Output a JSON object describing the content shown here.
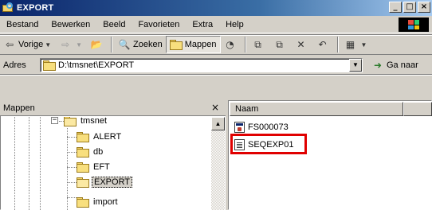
{
  "window": {
    "title": "EXPORT",
    "controls": [
      "_",
      "□",
      "×"
    ]
  },
  "menu": {
    "items": [
      "Bestand",
      "Bewerken",
      "Beeld",
      "Favorieten",
      "Extra",
      "Help"
    ]
  },
  "toolbar": {
    "back_label": "Vorige",
    "search_label": "Zoeken",
    "folders_label": "Mappen"
  },
  "address": {
    "label": "Adres",
    "value": "D:\\tmsnet\\EXPORT",
    "go_label": "Ga naar"
  },
  "folders_panel": {
    "title": "Mappen",
    "close": "×",
    "tree": [
      {
        "label": "tmsnet",
        "level": 0,
        "expanded": true
      },
      {
        "label": "ALERT",
        "level": 1
      },
      {
        "label": "db",
        "level": 1
      },
      {
        "label": "EFT",
        "level": 1
      },
      {
        "label": "EXPORT",
        "level": 1,
        "selected": true
      },
      {
        "label": "import",
        "level": 1
      }
    ]
  },
  "file_list": {
    "columns": [
      "Naam"
    ],
    "files": [
      {
        "name": "FS000073",
        "icon": "executable-icon"
      },
      {
        "name": "SEQEXP01",
        "icon": "text-file-icon",
        "highlighted": true
      }
    ]
  },
  "colors": {
    "titlebar": "#0a246a",
    "highlight": "#e00000",
    "chrome": "#d4d0c8"
  }
}
